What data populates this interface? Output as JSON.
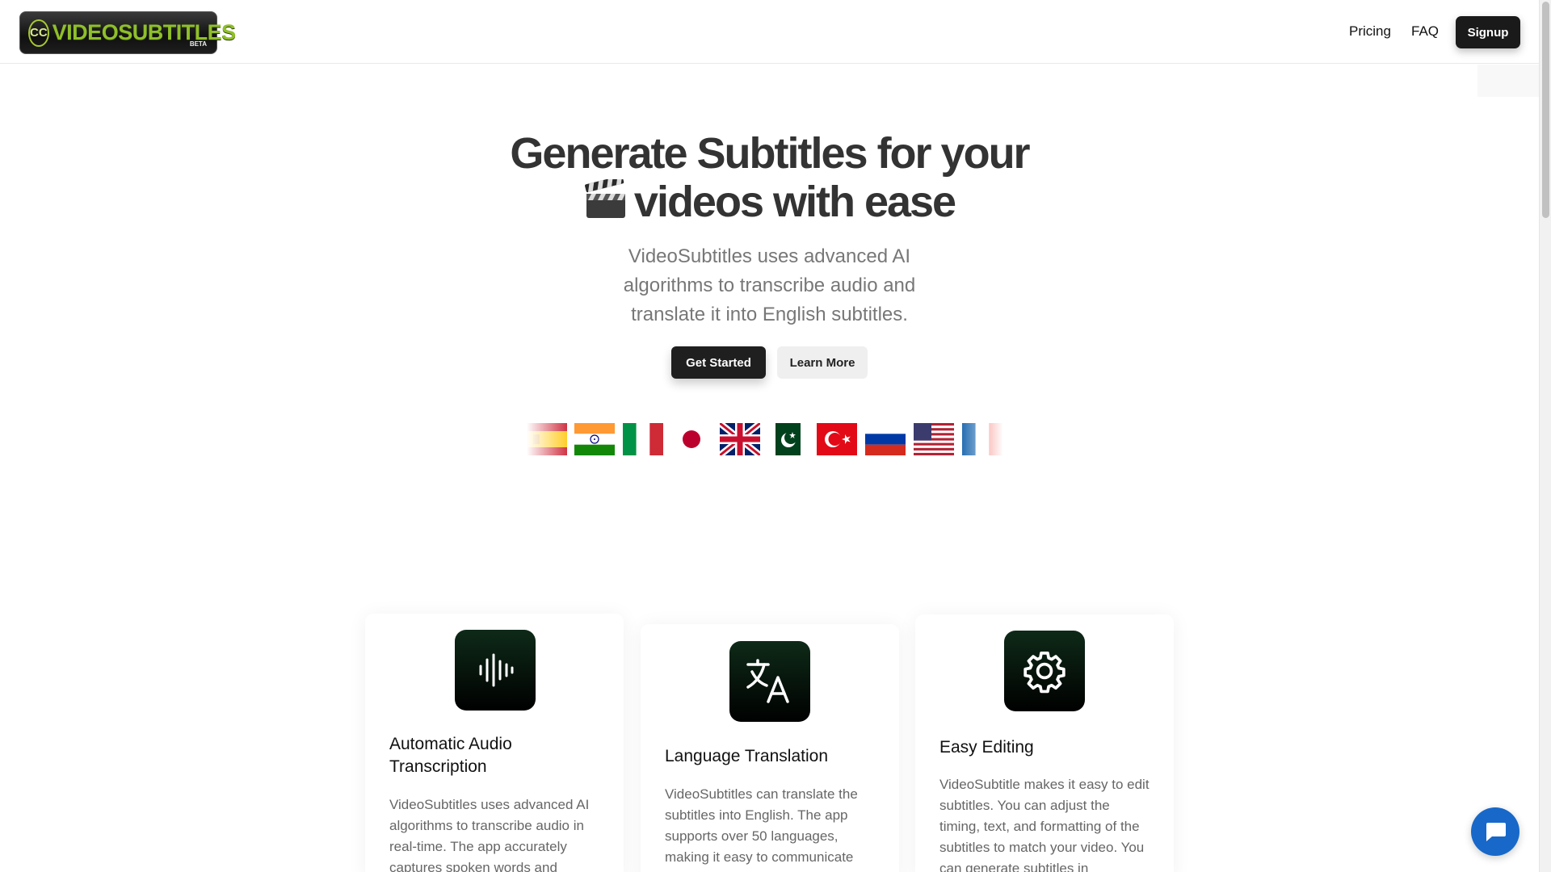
{
  "header": {
    "logo": {
      "cc": "CC",
      "text": "VIDEOSUBTITLES",
      "badge": "BETA"
    },
    "nav": [
      {
        "label": "Pricing"
      },
      {
        "label": "FAQ"
      }
    ],
    "signup_label": "Signup"
  },
  "hero": {
    "title_line1": "Generate Subtitles for your",
    "title_line2": "videos with ease",
    "title_icon": "clapper-board-icon",
    "subtitle": "VideoSubtitles uses advanced AI algorithms to transcribe audio and translate it into English subtitles.",
    "get_started_label": "Get Started",
    "learn_more_label": "Learn More"
  },
  "flags": [
    "spain",
    "india",
    "italy",
    "japan",
    "united-kingdom",
    "pakistan",
    "turkey",
    "russia",
    "united-states",
    "france"
  ],
  "features": [
    {
      "icon": "audio-waveform-icon",
      "title": "Automatic Audio Transcription",
      "text": "VideoSubtitles uses advanced AI algorithms to transcribe audio in real-time. The app accurately captures spoken words and"
    },
    {
      "icon": "translate-icon",
      "title": "Language Translation",
      "text": "VideoSubtitles can translate the subtitles into English. The app supports over 50 languages, making it easy to communicate"
    },
    {
      "icon": "gear-icon",
      "title": "Easy Editing",
      "text": "VideoSubtitle makes it easy to edit subtitles. You can adjust the timing, text, and formatting of the subtitles to match your video. You can generate subtitles in"
    }
  ],
  "colors": {
    "primary_button": "#1f1f1f",
    "feature_icon_bg": "#0e2a18",
    "logo_accent": "#8fbf2a",
    "chat_button": "#1768c9"
  },
  "chat": {
    "icon": "chat-bubble-icon"
  }
}
